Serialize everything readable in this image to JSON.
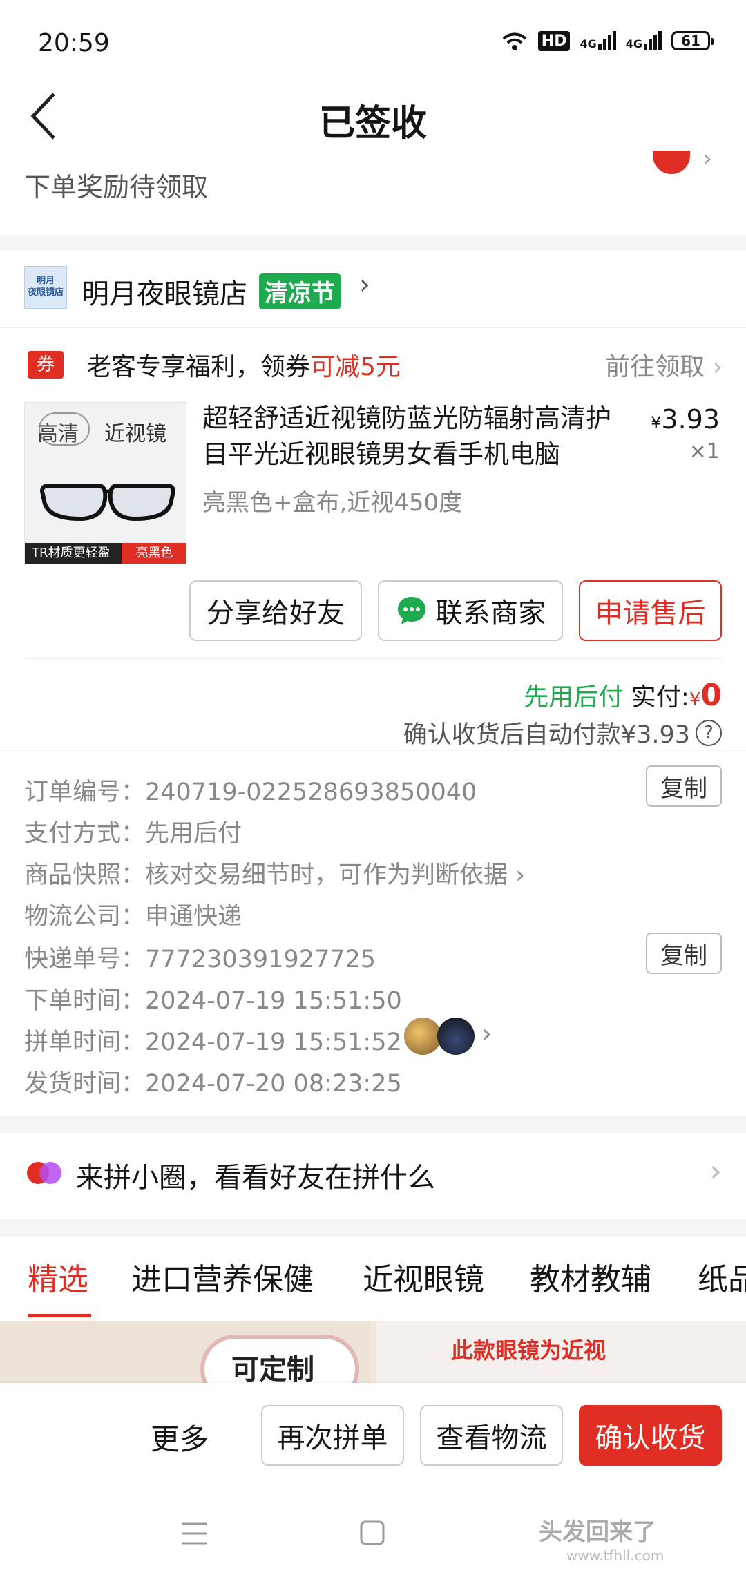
{
  "status_bar": {
    "time": "20:59",
    "hd": "HD",
    "net1": "4G",
    "net2": "4G",
    "battery": "61"
  },
  "nav": {
    "title": "已签收"
  },
  "reward": {
    "text": "下单奖励待领取"
  },
  "shop": {
    "logo_text": "明月\n夜眼镜店",
    "name": "明月夜眼镜店",
    "tag": "清凉节"
  },
  "coupon": {
    "icon": "券",
    "text": "老客专享福利，领券",
    "highlight": "可减5元",
    "action": "前往领取"
  },
  "product": {
    "image_label_1": "高清",
    "image_label_2": "近视镜",
    "image_band": "TR材质更轻盈",
    "image_band_red": "亮黑色",
    "title": "超轻舒适近视镜防蓝光防辐射高清护目平光近视眼镜男女看手机电脑",
    "price_symbol": "¥",
    "price": "3.93",
    "qty": "×1",
    "sku": "亮黑色+盒布,近视450度"
  },
  "actions": {
    "share": "分享给好友",
    "contact": "联系商家",
    "after_sale": "申请售后"
  },
  "payment": {
    "later": "先用后付",
    "paid_label": " 实付:",
    "cur": "¥",
    "paid": "0",
    "auto_pay": "确认收货后自动付款¥3.93",
    "help": "?"
  },
  "order_info": {
    "order_no_label": "订单编号：",
    "order_no": "240719-022528693850040",
    "pay_label": "支付方式：",
    "pay": "先用后付",
    "snapshot_label": "商品快照：",
    "snapshot": "核对交易细节时，可作为判断依据",
    "carrier_label": "物流公司：",
    "carrier": "申通快递",
    "tracking_label": "快递单号：",
    "tracking": "777230391927725",
    "ordered_label": "下单时间：",
    "ordered": "2024-07-19 15:51:50",
    "group_label": "拼单时间：",
    "group": "2024-07-19 15:51:52",
    "shipped_label": "发货时间：",
    "shipped": "2024-07-20 08:23:25",
    "copy": "复制"
  },
  "circle": {
    "text": "来拼小圈，看看好友在拼什么"
  },
  "tabs": [
    "精选",
    "进口营养保健",
    "近视眼镜",
    "教材教辅",
    "纸品"
  ],
  "banner": {
    "left_text": "可定制",
    "right_text": "此款眼镜为近视"
  },
  "bottom": {
    "more": "更多",
    "regroup": "再次拼单",
    "logistics": "查看物流",
    "confirm": "确认收货"
  },
  "watermark": {
    "text": "头发回来了",
    "url": "www.tfhll.com"
  },
  "colors": {
    "brand_red": "#e02e24",
    "green": "#1eaa4f"
  }
}
